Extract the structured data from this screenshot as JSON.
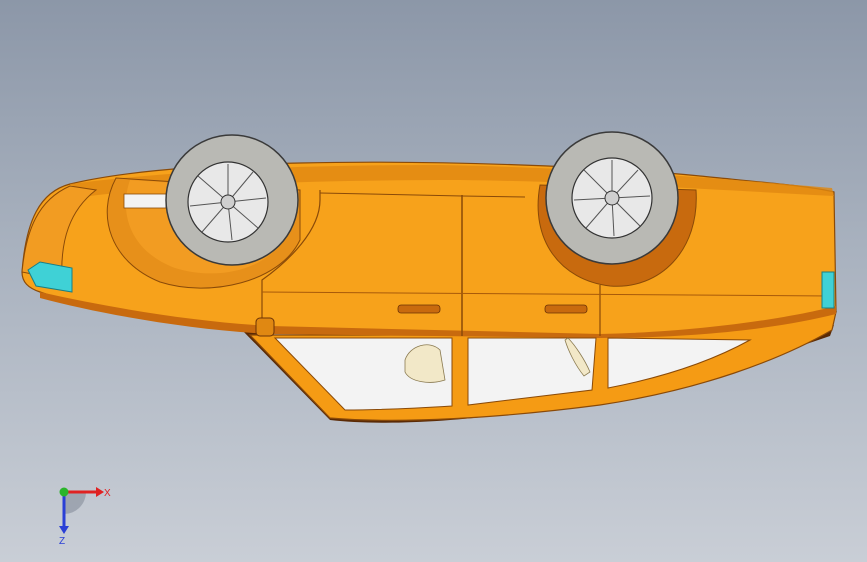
{
  "model": {
    "name": "car-body-upside-down",
    "body_color": "#f7a21b",
    "body_shade": "#c86a0e",
    "body_dark": "#6b3306",
    "glass_color": "#f3f3f3",
    "light_color": "#3fd1d6",
    "tire_color": "#b9b9b4",
    "rim_color": "#e8e8e8"
  },
  "triad": {
    "x_label": "X",
    "z_label": "Z",
    "x_color": "#e02222",
    "z_color": "#2a3fd6",
    "origin_color": "#2ab52a"
  }
}
